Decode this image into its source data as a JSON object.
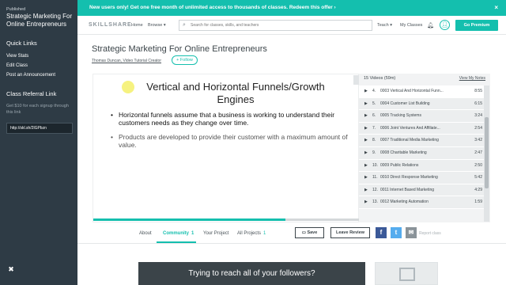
{
  "sidebar": {
    "status": "Published",
    "title": "Strategic Marketing For Online Entrepreneurs",
    "quick_links_heading": "Quick Links",
    "quick_links": [
      "View Stats",
      "Edit Class",
      "Post an Announcement"
    ],
    "referral_heading": "Class Referral Link",
    "referral_desc": "Get $10 for each signup through this link",
    "referral_link": "http://skl.sh/2lGPbzn",
    "close_glyph": "✖"
  },
  "banner": {
    "text": "New users only! Get one free month of unlimited access to thousands of classes. Redeem this offer ›",
    "close_glyph": "×"
  },
  "header": {
    "logo": "SKILLSHARE",
    "nav_home": "Home",
    "nav_browse": "Browse ▾",
    "search_placeholder": "Search for classes, skills, and teachers",
    "nav_teach": "Teach ▾",
    "nav_my_classes": "My Classes",
    "go_premium": "Go Premium",
    "accent": "#14bfae"
  },
  "class": {
    "title": "Strategic Marketing For Online Entrepreneurs",
    "teacher": "Thomas Duncan, Video Tutorial Creator",
    "follow": "+ Follow"
  },
  "slide": {
    "title": "Vertical and Horizontal Funnels/Growth Engines",
    "bullets": [
      "Horizontal funnels assume that a business is working to understand their customers needs as they change over time.",
      "Products are developed to provide their customer with a maximum amount of value."
    ],
    "progress": 0.72
  },
  "video_list": {
    "count_label": "15 Videos (59m)",
    "notes_link": "View My Notes",
    "items": [
      {
        "num": "4.",
        "title": "0003 Vertical And Horizontal Funn...",
        "duration": "8:55",
        "active": true
      },
      {
        "num": "5.",
        "title": "0004 Customer List Building",
        "duration": "6:15",
        "active": false
      },
      {
        "num": "6.",
        "title": "0005 Tracking Systems",
        "duration": "3:24",
        "active": false
      },
      {
        "num": "7.",
        "title": "0006 Joint Ventures And Affiliate...",
        "duration": "2:54",
        "active": false
      },
      {
        "num": "8.",
        "title": "0007 Traditional Media Marketing",
        "duration": "3:42",
        "active": false
      },
      {
        "num": "9.",
        "title": "0008 Charitable Marketing",
        "duration": "2:47",
        "active": false
      },
      {
        "num": "10.",
        "title": "0009 Public Relations",
        "duration": "2:50",
        "active": false
      },
      {
        "num": "11.",
        "title": "0010 Direct Response Marketing",
        "duration": "5:42",
        "active": false
      },
      {
        "num": "12.",
        "title": "0011 Internet Based Marketing",
        "duration": "4:29",
        "active": false
      },
      {
        "num": "13.",
        "title": "0012 Marketing Automation",
        "duration": "1:59",
        "active": false
      }
    ]
  },
  "tabs": {
    "about": "About",
    "community": "Community",
    "community_count": "1",
    "your_project": "Your Project",
    "all_projects": "All Projects",
    "all_projects_count": "1",
    "save": "Save",
    "leave_review": "Leave Review",
    "report": "Report class"
  },
  "social": {
    "facebook": {
      "glyph": "f",
      "color": "#3b5998"
    },
    "twitter": {
      "glyph": "t",
      "color": "#55acee"
    },
    "email": {
      "glyph": "✉",
      "color": "#8a9399"
    }
  },
  "promo": {
    "text": "Trying to reach all of your followers?"
  }
}
